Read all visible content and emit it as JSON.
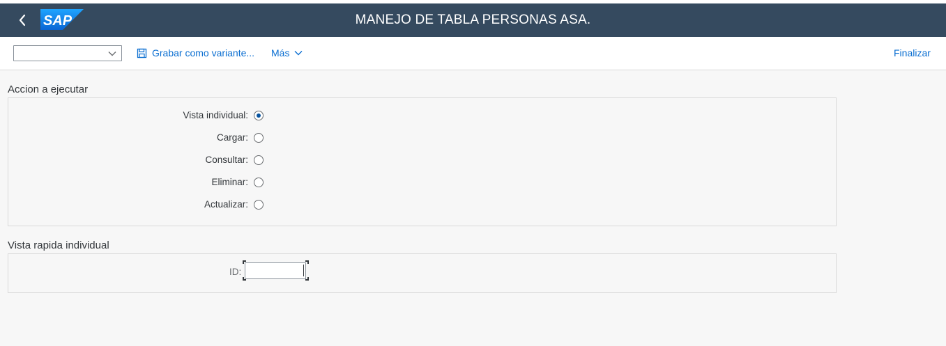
{
  "shell": {
    "title": "MANEJO DE TABLA PERSONAS ASA.",
    "logo_text": "SAP",
    "back_icon": "chevron-left-icon"
  },
  "toolbar": {
    "variant_value": "",
    "save_variant_label": "Grabar como variante...",
    "save_icon": "save-icon",
    "more_label": "Más",
    "finish_label": "Finalizar"
  },
  "action_section": {
    "title": "Accion a ejecutar",
    "options": [
      {
        "label": "Vista individual:",
        "selected": true
      },
      {
        "label": "Cargar:",
        "selected": false
      },
      {
        "label": "Consultar:",
        "selected": false
      },
      {
        "label": "Eliminar:",
        "selected": false
      },
      {
        "label": "Actualizar:",
        "selected": false
      }
    ]
  },
  "quick_view_section": {
    "title": "Vista rapida individual",
    "id_label": "ID:",
    "id_value": ""
  },
  "colors": {
    "shell_bg": "#354a5f",
    "accent": "#0a6ed1",
    "page_bg": "#f7f7f7",
    "radio_selected": "#0854a0"
  }
}
